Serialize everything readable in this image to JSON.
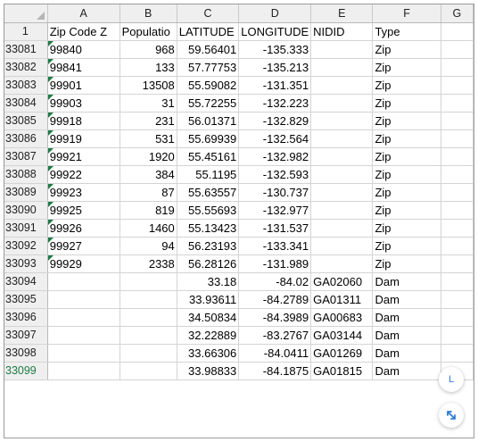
{
  "columns": [
    "A",
    "B",
    "C",
    "D",
    "E",
    "F",
    "G"
  ],
  "header_row": {
    "number": "1",
    "cells": [
      "Zip Code Z",
      "Populatio",
      "LATITUDE",
      "LONGITUDE",
      "NIDID",
      "Type",
      ""
    ]
  },
  "rows": [
    {
      "num": "33081",
      "cells": [
        "99840",
        "968",
        "59.56401",
        "-135.333",
        "",
        "Zip",
        ""
      ]
    },
    {
      "num": "33082",
      "cells": [
        "99841",
        "133",
        "57.77753",
        "-135.213",
        "",
        "Zip",
        ""
      ]
    },
    {
      "num": "33083",
      "cells": [
        "99901",
        "13508",
        "55.59082",
        "-131.351",
        "",
        "Zip",
        ""
      ]
    },
    {
      "num": "33084",
      "cells": [
        "99903",
        "31",
        "55.72255",
        "-132.223",
        "",
        "Zip",
        ""
      ]
    },
    {
      "num": "33085",
      "cells": [
        "99918",
        "231",
        "56.01371",
        "-132.829",
        "",
        "Zip",
        ""
      ]
    },
    {
      "num": "33086",
      "cells": [
        "99919",
        "531",
        "55.69939",
        "-132.564",
        "",
        "Zip",
        ""
      ]
    },
    {
      "num": "33087",
      "cells": [
        "99921",
        "1920",
        "55.45161",
        "-132.982",
        "",
        "Zip",
        ""
      ]
    },
    {
      "num": "33088",
      "cells": [
        "99922",
        "384",
        "55.1195",
        "-132.593",
        "",
        "Zip",
        ""
      ]
    },
    {
      "num": "33089",
      "cells": [
        "99923",
        "87",
        "55.63557",
        "-130.737",
        "",
        "Zip",
        ""
      ]
    },
    {
      "num": "33090",
      "cells": [
        "99925",
        "819",
        "55.55693",
        "-132.977",
        "",
        "Zip",
        ""
      ]
    },
    {
      "num": "33091",
      "cells": [
        "99926",
        "1460",
        "55.13423",
        "-131.537",
        "",
        "Zip",
        ""
      ]
    },
    {
      "num": "33092",
      "cells": [
        "99927",
        "94",
        "56.23193",
        "-133.341",
        "",
        "Zip",
        ""
      ]
    },
    {
      "num": "33093",
      "cells": [
        "99929",
        "2338",
        "56.28126",
        "-131.989",
        "",
        "Zip",
        ""
      ]
    },
    {
      "num": "33094",
      "cells": [
        "",
        "",
        "33.18",
        "-84.02",
        "GA02060",
        "Dam",
        ""
      ]
    },
    {
      "num": "33095",
      "cells": [
        "",
        "",
        "33.93611",
        "-84.2789",
        "GA01311",
        "Dam",
        ""
      ]
    },
    {
      "num": "33096",
      "cells": [
        "",
        "",
        "34.50834",
        "-84.3989",
        "GA00683",
        "Dam",
        ""
      ]
    },
    {
      "num": "33097",
      "cells": [
        "",
        "",
        "32.22889",
        "-83.2767",
        "GA03144",
        "Dam",
        ""
      ]
    },
    {
      "num": "33098",
      "cells": [
        "",
        "",
        "33.66306",
        "-84.0411",
        "GA01269",
        "Dam",
        ""
      ]
    },
    {
      "num": "33099",
      "cells": [
        "",
        "",
        "33.98833",
        "-84.1875",
        "GA01815",
        "Dam",
        ""
      ]
    }
  ],
  "floating_buttons": {
    "top_label": "L",
    "bottom_icon": "expand-arrow-icon"
  },
  "colors": {
    "accent": "#1e7b45",
    "header_bg": "#efefef",
    "button_icon": "#2f7cd6"
  }
}
